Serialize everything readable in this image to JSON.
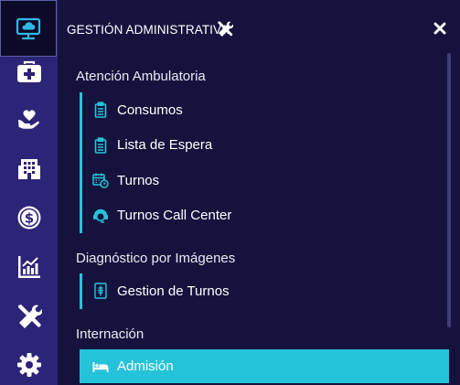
{
  "rail": {
    "items": [
      {
        "icon": "desktop-cloud-icon",
        "active": true
      },
      {
        "icon": "first-aid-kit-icon"
      },
      {
        "icon": "hand-heart-icon"
      },
      {
        "icon": "hospital-building-icon"
      },
      {
        "icon": "dollar-coin-icon"
      },
      {
        "icon": "bar-chart-icon"
      },
      {
        "icon": "tools-icon"
      },
      {
        "icon": "gear-icon"
      }
    ]
  },
  "panel": {
    "title": "GESTIÓN ADMINISTRATIVA",
    "title_icon": "tools-icon",
    "close_icon": "close-icon",
    "sections": [
      {
        "title": "Atención Ambulatoria",
        "items": [
          {
            "label": "Consumos",
            "icon": "clipboard-icon"
          },
          {
            "label": "Lista de Espera",
            "icon": "clipboard-icon"
          },
          {
            "label": "Turnos",
            "icon": "calendar-clock-icon"
          },
          {
            "label": "Turnos Call Center",
            "icon": "headset-agent-icon"
          }
        ]
      },
      {
        "title": "Diagnóstico por Imágenes",
        "items": [
          {
            "label": "Gestion de Turnos",
            "icon": "xray-icon"
          }
        ]
      },
      {
        "title": "Internación",
        "items": [
          {
            "label": "Admisión",
            "icon": "bed-icon",
            "selected": true
          }
        ]
      }
    ]
  },
  "colors": {
    "rail_bg": "#2c2477",
    "panel_bg": "#15133d",
    "accent": "#25c3d9",
    "active_rail_bg": "#0b0a28"
  }
}
